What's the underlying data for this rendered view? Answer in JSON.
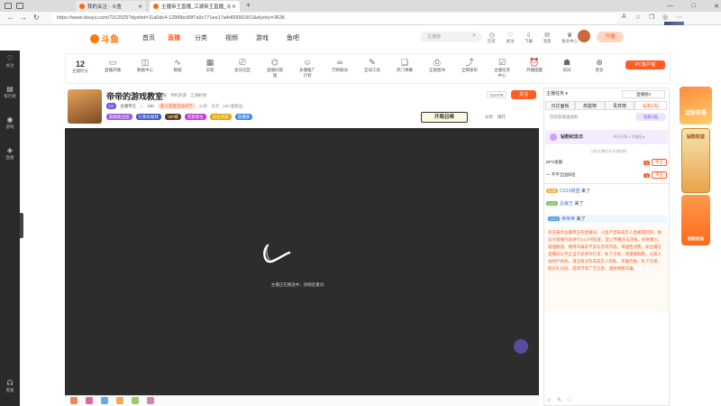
{
  "browser": {
    "tabs": [
      {
        "title": "我的关注 - 斗鱼",
        "active": false
      },
      {
        "title": "主播帝王直播_江湖帝王直播_斗...",
        "active": true
      }
    ],
    "new_tab": "+",
    "url": "https://www.douyu.com/7312525?dyshid=11a0dc4-129f0bc89f7a9c771ee17a4d00081601&dyshci=3636",
    "window_controls": [
      "—",
      "□",
      "✕"
    ]
  },
  "header": {
    "logo": "斗鱼",
    "nav": [
      "首页",
      "直播",
      "分类",
      "视频",
      "游戏",
      "鱼吧"
    ],
    "search_placeholder": "主播游",
    "user_icons": [
      "历史",
      "关注",
      "下载",
      "消息",
      "会员中心"
    ],
    "open_live": "开播"
  },
  "sidebar": {
    "items": [
      "关注",
      "排行榜",
      "游戏",
      "直播",
      "客服"
    ]
  },
  "toolbar": {
    "level_num": "12",
    "level_label": "主播时分",
    "tools": [
      "直播开播",
      "数据中心",
      "数据",
      "日程",
      "星光社区",
      "直播间管理",
      "多播推广计划",
      "万物联动",
      "互动工具",
      "热门弹幕",
      "正版图书",
      "全网发布",
      "主播任务中心",
      "开播提醒",
      "房间",
      "更多"
    ],
    "pc_client": "PC客户端"
  },
  "streamer": {
    "name": "帝帝的游戏教室",
    "tags": [
      "举报",
      "单机热游",
      "江湖射线"
    ],
    "room_id": "211078",
    "follow": "关注",
    "level": "主播帝王",
    "hot": "100",
    "fans": "多人连麦活动大厅",
    "rank_badges": [
      "超级粉丝团",
      "礼物贡献榜",
      "VIP榜",
      "贵族席位",
      "钻石贵族",
      "直播季"
    ],
    "share": "分享",
    "rank_label": "排行",
    "treasure": "开局召唤",
    "public_label": "公会：天元",
    "stats": "100 超粉丝"
  },
  "video": {
    "status": "主播正在路途中，请稍后重试"
  },
  "right": {
    "tabs": [
      "日达面板",
      "高能榜",
      "贵宾榜",
      "钻粉1钻"
    ],
    "rank_title": "直播榜2",
    "fanbadge": "钻粉纪念日",
    "fanbadge_sub": "当前主播还未开通钻粉",
    "rows": [
      {
        "label": "DPS金额",
        "val": "1",
        "btn": "帝王"
      },
      {
        "label": "一 不不全国排名",
        "val": "1",
        "btn": "帝王"
      }
    ],
    "chats": [
      {
        "lv": "LV35",
        "name": "CS10网盟",
        "msg": "来了"
      },
      {
        "lv": "LV21",
        "name": "总裁王",
        "msg": "来了"
      },
      {
        "lv": "LV12",
        "name": "帝帝帝",
        "msg": "来了"
      }
    ],
    "notice": "欢迎来到主播帝王的直播间。斗鱼严禁未成年人直播或打赏。依法对直播内容进行24小时巡查，禁止传播违法违规、低俗暴力、吸烟酗酒、赌博诈骗等不良信息等内容。请理性消费，如主播在直播间以不正当方式诱导打赏、私下交易，请谨慎判断，以防人身财产损失。请注意涉及未成年人隐私、诈骗代拍、私下交易、购买礼包码、游戏币等广告信息，谨防网络诈骗。"
  },
  "ads": {
    "ad1": "话粉祈愿",
    "ad2": "钻粉权益",
    "ad3": "钻粉权益"
  },
  "colors": {
    "accent": "#ff5d23",
    "douyu_orange": "#ff7a00",
    "video_bg": "#2d2d2d",
    "sidebar_bg": "#2a2a2a"
  }
}
